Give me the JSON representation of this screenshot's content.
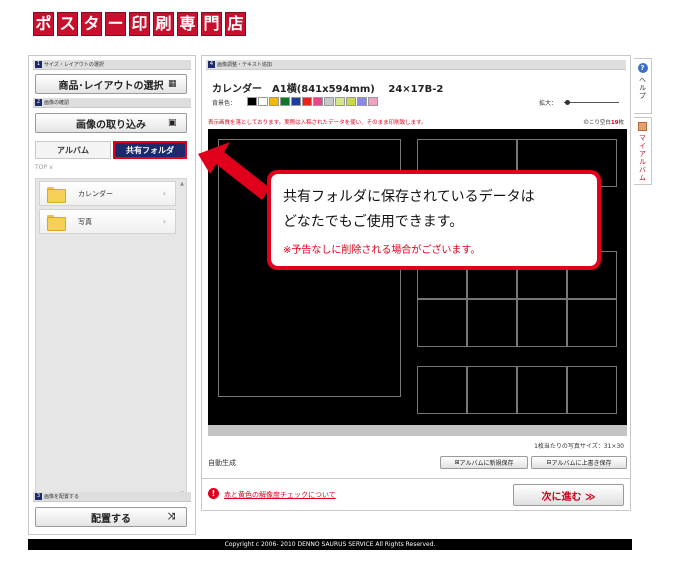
{
  "logo": {
    "chars": [
      "ポ",
      "ス",
      "タ",
      "ー",
      "印",
      "刷",
      "専",
      "門",
      "店"
    ]
  },
  "left": {
    "section1": {
      "num": "1",
      "label": "サイズ・レイアウトの選択"
    },
    "select_layout_button": "商品･レイアウトの選択",
    "section2": {
      "num": "2",
      "label": "画像の確認"
    },
    "import_button": "画像の取り込み",
    "tabs": {
      "album": "アルバム",
      "shared": "共有フォルダ"
    },
    "breadcrumb": "TOP ∨",
    "folders": [
      {
        "label": "カレンダー"
      },
      {
        "label": "写真"
      }
    ],
    "section3": {
      "num": "3",
      "label": "画像を配置する"
    },
    "place_button": "配置する"
  },
  "main": {
    "section4": {
      "num": "4",
      "label": "画像調整・テキスト追加"
    },
    "product_title": "カレンダー　A1横(841x594mm)　 24×17B-2",
    "bg_label": "背景色：",
    "bg_colors": [
      "#000000",
      "#ffffff",
      "#f5b800",
      "#0a7a2a",
      "#1a3d9e",
      "#e8231a",
      "#e34a8c",
      "#c8c8c8",
      "#d6e68a",
      "#c9d94a",
      "#8a8ae6",
      "#f3a0c0"
    ],
    "zoom_label": "拡大：",
    "zoom_value": 0.05,
    "notice": "表示画質を落としております。実際は入稿されたデータを使い、そのまま印刷致します。",
    "remaining_prefix": "のこり空白",
    "remaining_count": "19",
    "remaining_suffix": "枚",
    "per_sheet": "1枚当たりの写真サイズ：31×30",
    "auto_gen": "自動生成",
    "save_new_button": "アルバムに新規保存",
    "overwrite_button": "アルバムに上書き保存",
    "warning_link": "赤と黄色の解像度チェックについて",
    "next_button": "次に進む ≫"
  },
  "side": {
    "help": "ヘルプ",
    "my_album": "マイアルバム"
  },
  "callout": {
    "line1": "共有フォルダに保存されているデータは",
    "line2": "どなたでもご使用できます。",
    "note": "※予告なしに削除される場合がございます。"
  },
  "footer": "Copyright c 2006- 2010 DENNO SAURUS SERVICE All Rights Reserved."
}
